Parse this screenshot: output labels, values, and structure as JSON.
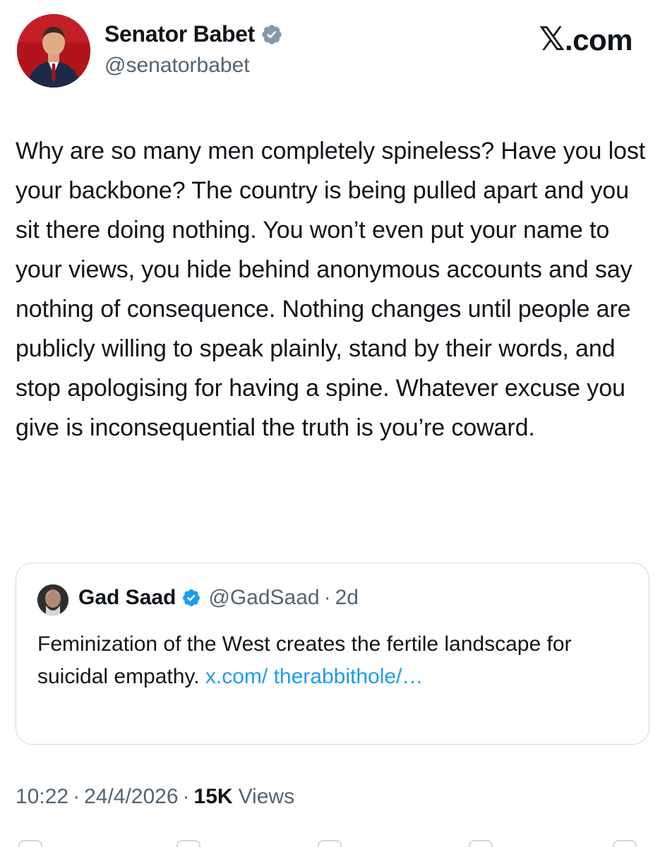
{
  "author": {
    "display_name": "Senator Babet",
    "handle": "@senatorbabet",
    "verified_icon": "verified-badge-icon",
    "avatar_bg": "#b3141c"
  },
  "brand": {
    "logo_text": "𝕏",
    "domain": ".com"
  },
  "tweet": {
    "text": "Why are so many men completely spineless? Have you lost your backbone? The country is being pulled apart and you sit there doing nothing. You won’t even put your name to your views, you hide behind anonymous accounts and say nothing of consequence. Nothing changes until people are publicly willing to speak plainly, stand by their words, and stop apologising for having a spine. Whatever excuse you give is inconsequential the truth is you’re coward."
  },
  "quote": {
    "display_name": "Gad Saad",
    "handle": "@GadSaad",
    "separator": "·",
    "time": "2d",
    "text": "Feminization of the West creates the fertile landscape for suicidal empathy. ",
    "link": "x.com/ therabbithole/…"
  },
  "meta": {
    "time": "10:22",
    "date": "24/4/2026",
    "sep1": "·",
    "sep2": "·",
    "views_count": "15K",
    "views_label": "Views"
  },
  "colors": {
    "text": "#0f1419",
    "secondary": "#536471",
    "link": "#1d9bf0",
    "border": "#cfd9de",
    "verified": "#1d9bf0"
  }
}
